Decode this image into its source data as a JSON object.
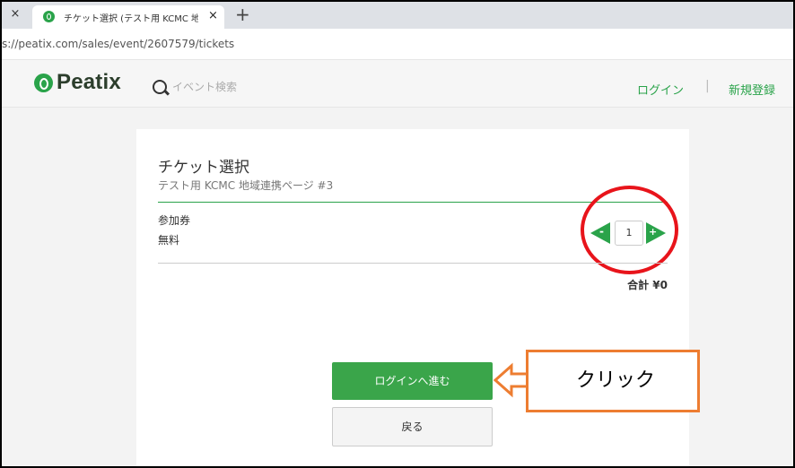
{
  "browser": {
    "prev_tab_close": "×",
    "tab_title": "チケット選択 (テスト用  KCMC  地",
    "tab_close": "×",
    "new_tab": "+",
    "url": "s://peatix.com/sales/event/2607579/tickets"
  },
  "header": {
    "logo_text": "Peatix",
    "search_placeholder": "イベント検索",
    "login": "ログイン",
    "separator": "|",
    "register": "新規登録"
  },
  "ticket_page": {
    "title": "チケット選択",
    "subtitle": "テスト用  KCMC  地域連携ページ #3",
    "ticket_name": "参加券",
    "ticket_price": "無料",
    "minus": "-",
    "quantity": "1",
    "plus": "+",
    "total": "合計 ¥0",
    "proceed_button": "ログインへ進む",
    "back_button": "戻る"
  },
  "annotation": {
    "callout_text": "クリック"
  },
  "colors": {
    "brand_green": "#2aa34a",
    "highlight_red": "#e8141b",
    "callout_orange": "#ed7d31"
  }
}
